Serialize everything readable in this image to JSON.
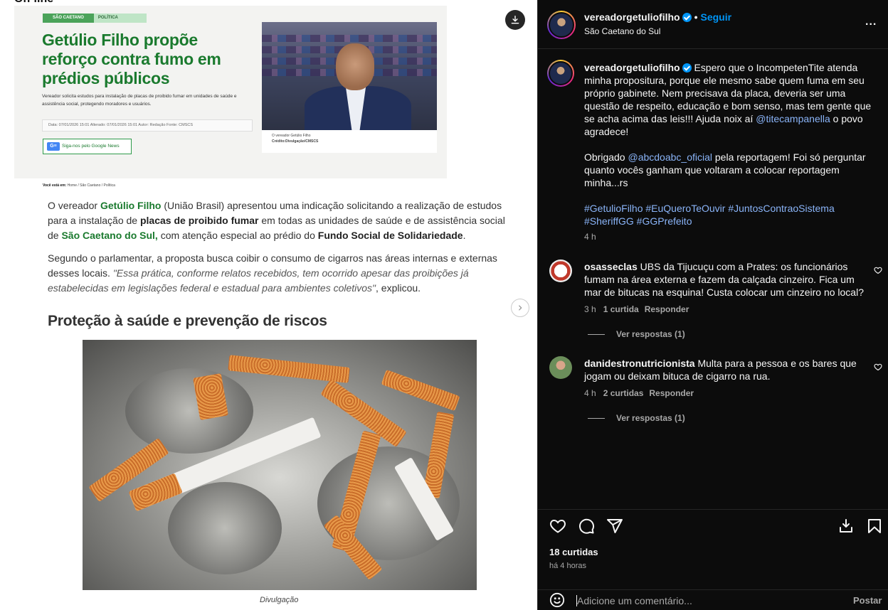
{
  "media": {
    "top_label": "On-line",
    "article": {
      "tag_city": "SÃO CAETANO",
      "tag_section": "POLÍTICA",
      "headline": "Getúlio Filho propõe reforço contra fumo em prédios públicos",
      "dek": "Vereador solicita estudos para instalação de placas de proibido fumar em unidades de saúde e assistência social, protegendo moradores e usuários.",
      "meta": "Data: 07/01/2026 15:01    Alterado: 07/01/2026 15:01    Autor: Redação    Fonte: CMSCS",
      "google_news": "Siga-nos pelo Google News",
      "photo_caption": "O vereador Getúlio Filho",
      "photo_credit": "Crédito:Divulgação/CMSCS",
      "breadcrumb_label": "Você está em:",
      "breadcrumb": "Home  /  São Caetano  /  Política",
      "para1": {
        "t1": "O vereador ",
        "b1": "Getúlio Filho",
        "t2": " (União Brasil) apresentou uma indicação solicitando a realização de estudos para a instalação de ",
        "b2": "placas de proibido fumar",
        "t3": " em todas as unidades de saúde e de assistência social de ",
        "b3": "São Caetano do Sul,",
        "t4": " com atenção especial ao prédio do ",
        "b4": "Fundo Social de Solidariedade",
        "t5": "."
      },
      "para2": {
        "t1": "Segundo o parlamentar, a proposta busca coibir o consumo de cigarros nas áreas internas e externas desses locais. ",
        "i1": "\"Essa prática, conforme relatos recebidos, tem ocorrido apesar das proibições já estabelecidas em legislações federal e estadual para ambientes coletivos\"",
        "t2": ", explicou."
      },
      "subheading": "Proteção à saúde e prevenção de riscos",
      "image_caption": "Divulgação"
    }
  },
  "panel": {
    "header": {
      "username": "vereadorgetuliofilho",
      "follow": "Seguir",
      "location": "São Caetano do Sul",
      "more": "..."
    },
    "caption": {
      "username": "vereadorgetuliofilho",
      "p1_a": " Espero que o IncompetenTite atenda minha propositura, porque ele mesmo sabe quem fuma em seu próprio gabinete. Nem precisava da placa, deveria ser uma questão de respeito, educação e bom senso, mas tem gente que se acha acima das leis!!! Ajuda noix aí ",
      "p1_mention": "@titecampanella",
      "p1_b": " o povo agradece!",
      "p2_a": "Obrigado ",
      "p2_mention": "@abcdoabc_oficial",
      "p2_b": " pela reportagem! Foi só perguntar quanto vocês ganham que voltaram a colocar reportagem minha...rs",
      "hashtags": "#GetulioFilho #EuQueroTeOuvir #JuntosContraoSistema #SheriffGG #GGPrefeito",
      "time": "4 h"
    },
    "comments": [
      {
        "username": "osasseclas",
        "text": " UBS da Tijucuçu com a Prates: os funcionários fumam na área externa e fazem da calçada cinzeiro. Fica um mar de bitucas na esquina! Custa colocar um cinzeiro no local?",
        "time": "3 h",
        "likes": "1 curtida",
        "reply": "Responder",
        "view_replies": "Ver respostas (1)"
      },
      {
        "username": "danidestronutricionista",
        "text": " Multa para a pessoa e os bares que jogam ou deixam bituca de cigarro na rua.",
        "time": "4 h",
        "likes": "2 curtidas",
        "reply": "Responder",
        "view_replies": "Ver respostas (1)"
      }
    ],
    "likes": "18 curtidas",
    "ago": "há 4 horas",
    "comment_placeholder": "Adicione um comentário...",
    "post": "Postar"
  },
  "colors": {
    "accent_green": "#1a7a2e",
    "instagram_blue": "#0095f6",
    "panel_bg": "#0c0c0c"
  }
}
